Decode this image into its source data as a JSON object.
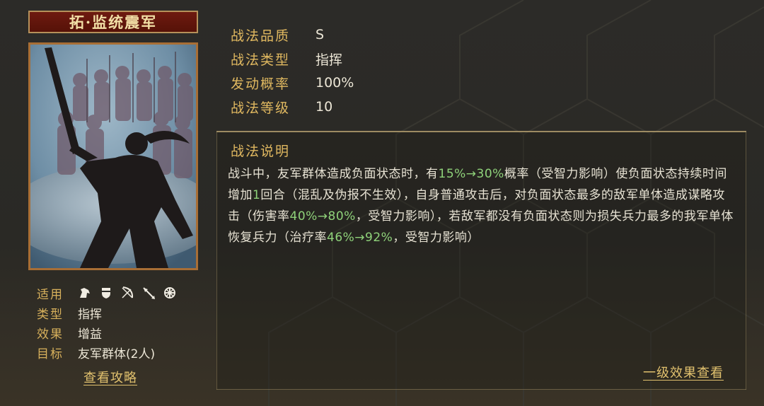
{
  "skill": {
    "name": "拓·监统震军"
  },
  "meta": {
    "applicable_label": "适用",
    "unit_icons": [
      "cavalry-icon",
      "shield-icon",
      "bow-icon",
      "spear-icon",
      "siege-icon"
    ],
    "type_label": "类型",
    "type_value": "指挥",
    "effect_label": "效果",
    "effect_value": "增益",
    "target_label": "目标",
    "target_value": "友军群体(2人)"
  },
  "guide_link": "查看攻略",
  "attributes": [
    {
      "key": "战法品质",
      "value": "S"
    },
    {
      "key": "战法类型",
      "value": "指挥"
    },
    {
      "key": "发动概率",
      "value": "100%"
    },
    {
      "key": "战法等级",
      "value": "10"
    }
  ],
  "description": {
    "title": "战法说明",
    "segments": [
      {
        "text": "战斗中，友军群体造成负面状态时，有"
      },
      {
        "text": "15%→30%",
        "hl": true
      },
      {
        "text": "概率（受智力影响）使负面状态持续时间增加"
      },
      {
        "text": "1",
        "hl": true
      },
      {
        "text": "回合（混乱及伪报不生效），自身普通攻击后，对负面状态最多的敌军单体造成谋略攻击（伤害率"
      },
      {
        "text": "40%→80%",
        "hl": true
      },
      {
        "text": "，受智力影响），若敌军都没有负面状态则为损失兵力最多的我军单体恢复兵力（治疗率"
      },
      {
        "text": "46%→92%",
        "hl": true
      },
      {
        "text": "，受智力影响）"
      }
    ]
  },
  "effect_link": "一级效果查看",
  "colors": {
    "gold": "#e0b860",
    "highlight": "#8fd27a",
    "title_plate": "#6e1a10",
    "text": "#ece6d6"
  }
}
